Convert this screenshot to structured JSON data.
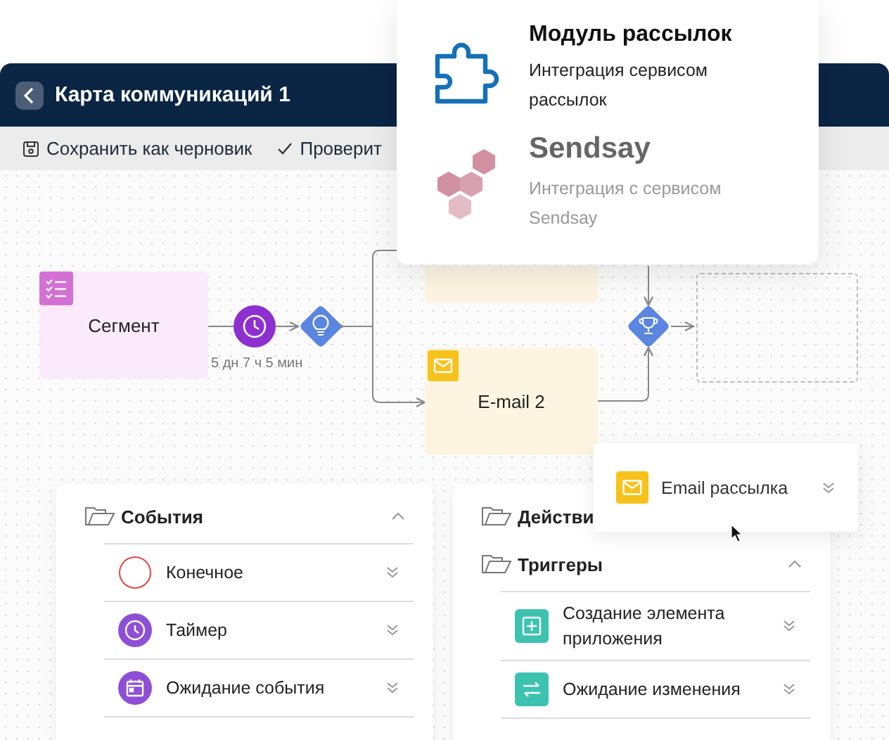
{
  "window": {
    "title": "Карта коммуникаций 1"
  },
  "toolbar": [
    {
      "kind": "save",
      "label": "Сохранить как черновик"
    },
    {
      "kind": "check",
      "label": "Проверит"
    }
  ],
  "flow": {
    "segment": {
      "label": "Сегмент"
    },
    "timer": {
      "label": "5 дн 7 ч 5 мин"
    },
    "email": {
      "label": "E-mail 2"
    }
  },
  "integrations": [
    {
      "kind": "puzzle",
      "title": "Модуль рассылок",
      "subtitle": "Интеграция сервисом рассылок",
      "disabled": false
    },
    {
      "kind": "sendsay",
      "title": "Sendsay",
      "subtitle": "Интеграция с сервисом Sendsay",
      "disabled": true
    }
  ],
  "panels": [
    {
      "groups": [
        {
          "title": "События",
          "expanded": true,
          "items": [
            {
              "kind": "end",
              "label": "Конечное"
            },
            {
              "kind": "timer",
              "label": "Таймер"
            },
            {
              "kind": "wait",
              "label": "Ожидание события"
            }
          ]
        }
      ]
    },
    {
      "groups": [
        {
          "title": "Действи"
        },
        {
          "title": "Триггеры",
          "expanded": true,
          "items": [
            {
              "kind": "create",
              "label": "Создание элемента приложения"
            },
            {
              "kind": "change",
              "label": "Ожидание  изменения"
            }
          ]
        }
      ]
    }
  ],
  "drag_card": {
    "kind": "email",
    "label": "Email рассылка"
  }
}
